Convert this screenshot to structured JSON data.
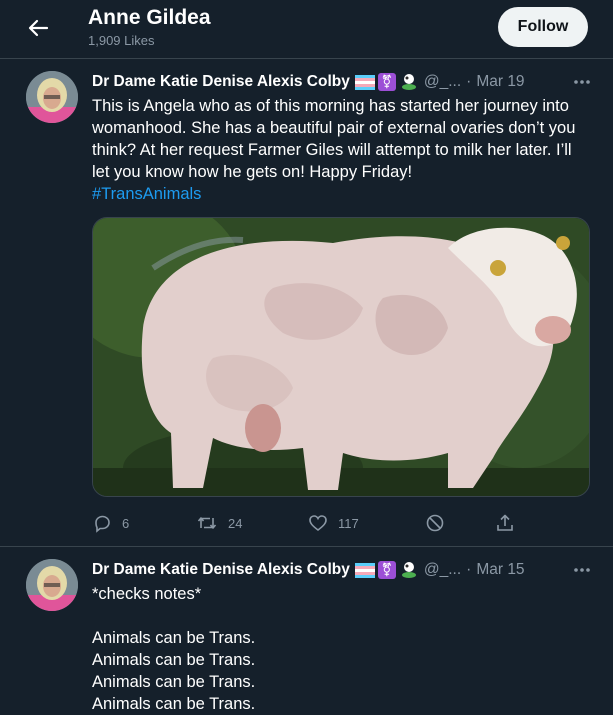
{
  "header": {
    "title": "Anne Gildea",
    "subtitle": "1,909 Likes",
    "follow_label": "Follow"
  },
  "tweets": [
    {
      "author": "Dr Dame Katie Denise Alexis Colby",
      "handle": "@_...",
      "date": "Mar 19",
      "text": "This is Angela who as of this morning has started her journey into womanhood. She has a beautiful pair of external ovaries don’t you think? At her request Farmer Giles will attempt to milk her later. I’ll let you know how he gets on! Happy Friday!",
      "hashtag": "#TransAnimals",
      "replies": "6",
      "retweets": "24",
      "likes": "117"
    },
    {
      "author": "Dr Dame Katie Denise Alexis Colby",
      "handle": "@_...",
      "date": "Mar 15",
      "lines": [
        "*checks notes*",
        "",
        "Animals can be Trans.",
        "Animals can be Trans.",
        "Animals can be Trans.",
        "Animals can be Trans."
      ]
    }
  ],
  "colors": {
    "background": "#15202b",
    "divider": "#38444d",
    "secondary_text": "#8b98a5",
    "link": "#1d9bf0",
    "follow_bg": "#eff3f4"
  },
  "icons": [
    "back-arrow-icon",
    "more-icon",
    "reply-icon",
    "retweet-icon",
    "like-icon",
    "block-icon",
    "share-icon",
    "trans-flag-icon",
    "trans-symbol-icon",
    "cow-emoji-icon"
  ]
}
